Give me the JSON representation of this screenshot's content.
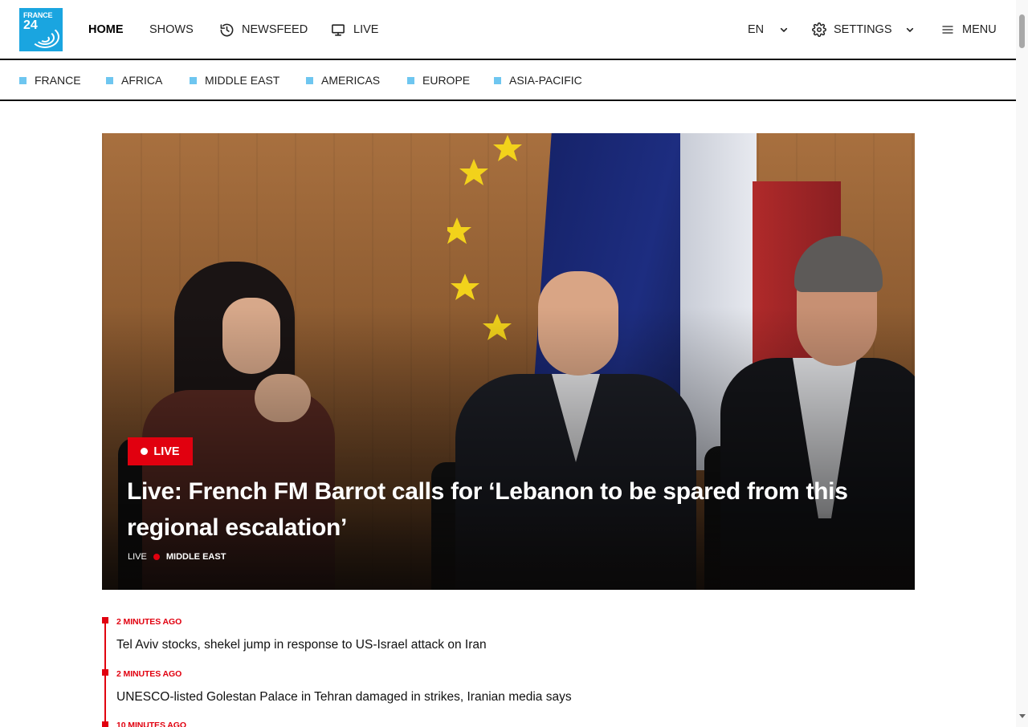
{
  "logo": {
    "line1": "FRANCE",
    "line2": "24",
    "brand_color": "#1aa5e0"
  },
  "nav": {
    "home": "HOME",
    "shows": "SHOWS",
    "newsfeed": "NEWSFEED",
    "live": "LIVE",
    "language": "EN",
    "settings": "SETTINGS",
    "menu": "MENU"
  },
  "icons": {
    "newsfeed": "history-icon",
    "live": "monitor-icon",
    "language": "chevron-down-icon",
    "settings": "gear-icon",
    "menu": "hamburger-icon"
  },
  "regions": [
    "FRANCE",
    "AFRICA",
    "MIDDLE EAST",
    "AMERICAS",
    "EUROPE",
    "ASIA-PACIFIC"
  ],
  "hero": {
    "badge": "LIVE",
    "title": "Live: French FM Barrot calls for ‘Lebanon to be spared from this regional escalation’",
    "meta_live": "LIVE",
    "meta_category": "MIDDLE EAST",
    "accent_color": "#e1000f"
  },
  "feed": [
    {
      "time": "2 MINUTES AGO",
      "text": "Tel Aviv stocks, shekel jump in response to US-Israel attack on Iran"
    },
    {
      "time": "2 MINUTES AGO",
      "text": "UNESCO-listed Golestan Palace in Tehran damaged in strikes, Iranian media says"
    },
    {
      "time": "10 MINUTES AGO",
      "text": ""
    }
  ]
}
